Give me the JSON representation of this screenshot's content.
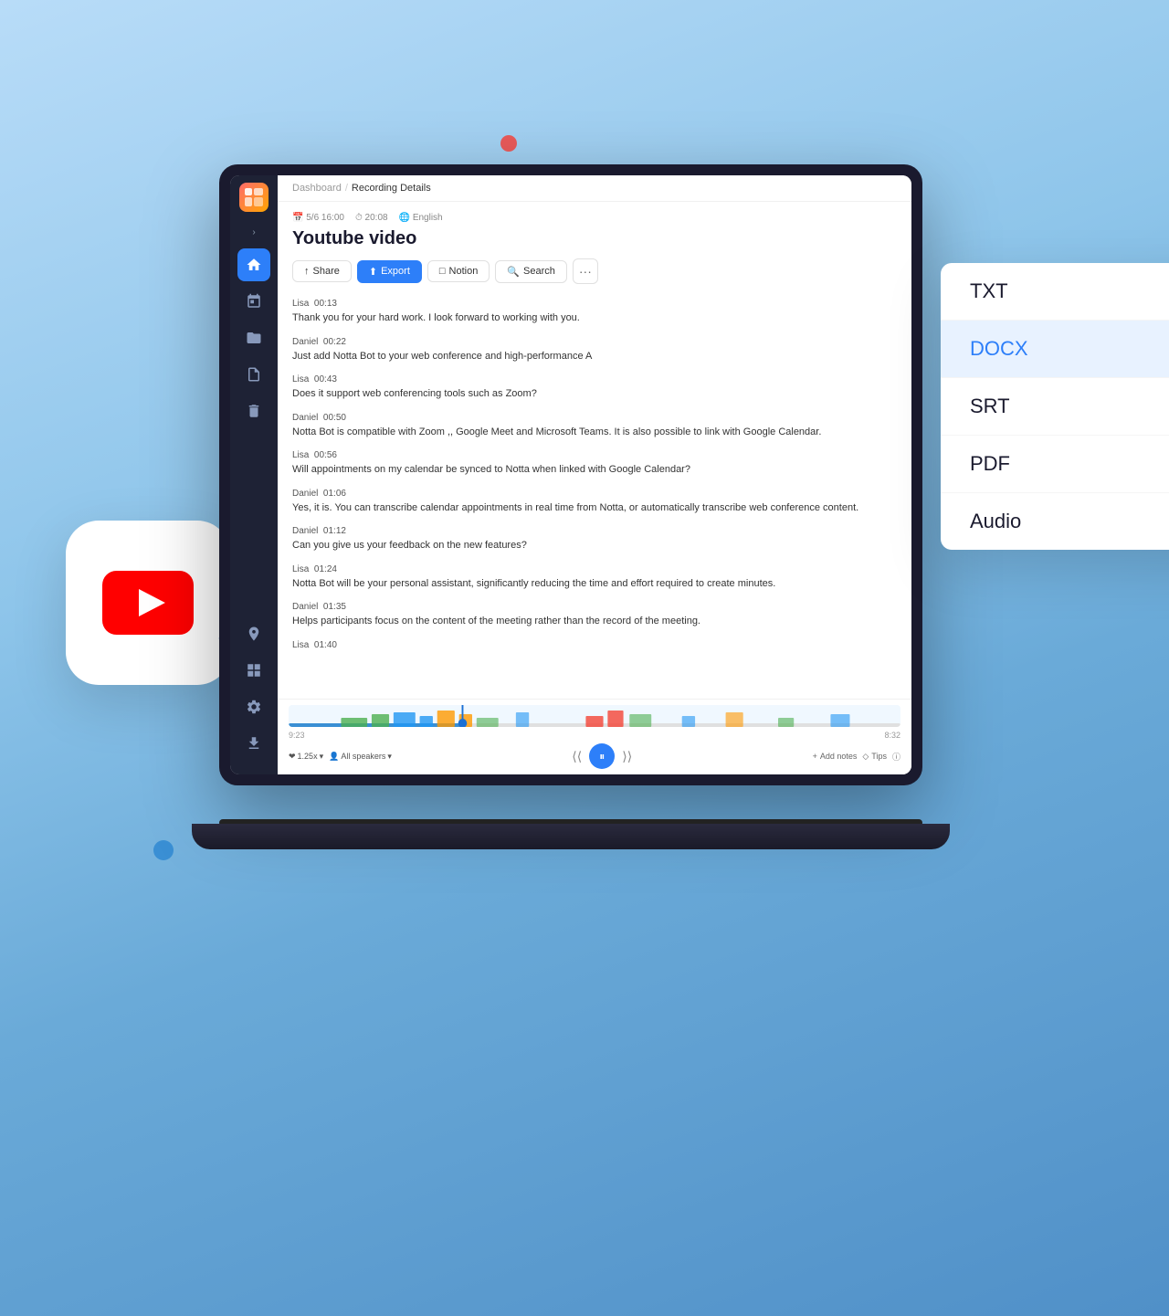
{
  "page": {
    "bg_color": "#a8d8f0"
  },
  "sidebar": {
    "items": [
      {
        "id": "home",
        "active": true
      },
      {
        "id": "calendar"
      },
      {
        "id": "folder"
      },
      {
        "id": "document"
      },
      {
        "id": "trash"
      }
    ],
    "bottom_items": [
      {
        "id": "location"
      },
      {
        "id": "grid"
      },
      {
        "id": "settings"
      },
      {
        "id": "download"
      }
    ]
  },
  "breadcrumb": {
    "parent": "Dashboard",
    "separator": "/",
    "current": "Recording Details"
  },
  "recording": {
    "meta": {
      "date": "5/6 16:00",
      "duration": "20:08",
      "language": "English"
    },
    "title": "Youtube video",
    "actions": {
      "share": "Share",
      "export": "Export",
      "notion": "Notion",
      "search": "Search",
      "more": "···"
    }
  },
  "transcript": [
    {
      "speaker": "Lisa",
      "time": "00:13",
      "text": "Thank you for your hard work. I look forward to working with you."
    },
    {
      "speaker": "Daniel",
      "time": "00:22",
      "text": "Just add Notta Bot to your web conference and high-performance A"
    },
    {
      "speaker": "Lisa",
      "time": "00:43",
      "text": "Does it support web conferencing tools such as Zoom?"
    },
    {
      "speaker": "Daniel",
      "time": "00:50",
      "text": "Notta Bot is compatible with Zoom ,, Google Meet and Microsoft Teams. It is also possible to link with Google Calendar."
    },
    {
      "speaker": "Lisa",
      "time": "00:56",
      "text": "Will appointments on my calendar be synced to Notta when linked with Google Calendar?"
    },
    {
      "speaker": "Daniel",
      "time": "01:06",
      "text": "Yes, it is. You can transcribe calendar appointments in real time from Notta, or automatically transcribe web conference content."
    },
    {
      "speaker": "Daniel",
      "time": "01:12",
      "text": "Can you give us your feedback on the new features?"
    },
    {
      "speaker": "Lisa",
      "time": "01:24",
      "text": "Notta Bot will be your personal assistant, significantly reducing the time and effort required to create minutes."
    },
    {
      "speaker": "Daniel",
      "time": "01:35",
      "text": "Helps participants focus on the content of the meeting rather than the record of the meeting."
    },
    {
      "speaker": "Lisa",
      "time": "01:40",
      "text": ""
    }
  ],
  "player": {
    "current_time": "9:23",
    "total_time": "8:32",
    "speed": "1.25x",
    "speakers": "All speakers",
    "controls": {
      "rewind": "⟨",
      "play": "⏸",
      "forward": "⟩"
    },
    "add_notes": "Add notes",
    "tips": "Tips"
  },
  "export_dropdown": {
    "options": [
      {
        "id": "txt",
        "label": "TXT",
        "highlighted": false
      },
      {
        "id": "docx",
        "label": "DOCX",
        "highlighted": true
      },
      {
        "id": "srt",
        "label": "SRT",
        "highlighted": false
      },
      {
        "id": "pdf",
        "label": "PDF",
        "highlighted": false
      },
      {
        "id": "audio",
        "label": "Audio",
        "highlighted": false
      }
    ]
  },
  "youtube_icon": {
    "label": "YouTube"
  }
}
